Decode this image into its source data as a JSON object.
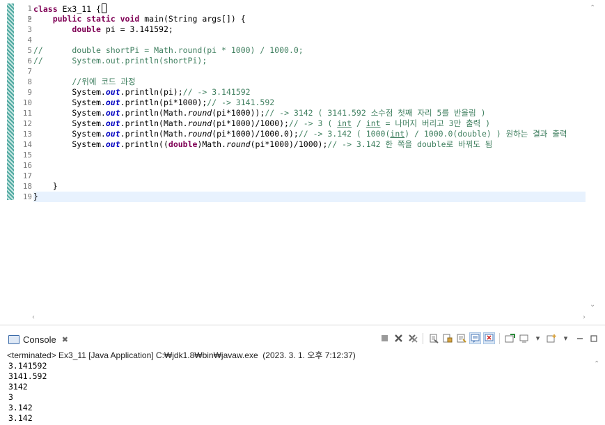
{
  "editor": {
    "line_numbers": [
      "1",
      "2",
      "3",
      "4",
      "5",
      "6",
      "7",
      "8",
      "9",
      "10",
      "11",
      "12",
      "13",
      "14",
      "15",
      "16",
      "17",
      "18",
      "19"
    ],
    "fold_marker": "⊖",
    "lines": {
      "l1": {
        "kw": "class",
        "rest": " Ex3_11 {"
      },
      "l2": {
        "indent": "    ",
        "kw1": "public static void",
        "rest": " main(String args[]) {"
      },
      "l3": {
        "indent": "        ",
        "kw": "double",
        "rest": " pi = 3.141592;"
      },
      "l5": "//      double shortPi = Math.round(pi * 1000) / 1000.0;",
      "l6": "//      System.out.println(shortPi);",
      "l8": "        //위에 코드 과정",
      "l9": {
        "a": "        System.",
        "field": "out",
        "b": ".println(pi);",
        "c": "// -> 3.141592"
      },
      "l10": {
        "a": "        System.",
        "field": "out",
        "b": ".println(pi*1000);",
        "c": "// -> 3141.592"
      },
      "l11": {
        "a": "        System.",
        "field": "out",
        "b": ".println(Math.",
        "m": "round",
        "d": "(pi*1000));",
        "c": "// -> 3142 ( 3141.592 소수점 첫째 자리 5를 반올림 )"
      },
      "l12": {
        "a": "        System.",
        "field": "out",
        "b": ".println(Math.",
        "m": "round",
        "d": "(pi*1000)/1000);",
        "c1": "// -> 3 ( ",
        "u1": "int",
        "c2": " / ",
        "u2": "int",
        "c3": " = 나머지 버리고 3만 출력 )"
      },
      "l13": {
        "a": "        System.",
        "field": "out",
        "b": ".println(Math.",
        "m": "round",
        "d": "(pi*1000)/1000.0);",
        "c1": "// -> 3.142 ( 1000(",
        "u1": "int",
        "c3": ") / 1000.0(double) ) 원하는 결과 출력"
      },
      "l14": {
        "a": "        System.",
        "field": "out",
        "b": ".println((",
        "kw": "double",
        "b2": ")Math.",
        "m": "round",
        "d": "(pi*1000)/1000);",
        "c": "// -> 3.142 한 쪽을 double로 바꿔도 됨"
      },
      "l18": "    }",
      "l19": "}"
    }
  },
  "console": {
    "tab_label": "Console",
    "tab_close": "✖",
    "status": "<terminated> Ex3_11 [Java Application] C:₩jdk1.8₩bin₩javaw.exe  (2023. 3. 1. 오후 7:12:37)",
    "output": [
      "3.141592",
      "3141.592",
      "3142",
      "3",
      "3.142",
      "3.142"
    ]
  },
  "toolbar": {
    "icons": [
      "terminate-icon",
      "remove-launch-icon",
      "remove-all-icon",
      "clear-console-icon",
      "scroll-lock-icon",
      "word-wrap-icon",
      "show-stdout-icon",
      "show-stderr-icon",
      "pin-console-icon",
      "display-console-icon",
      "open-console-icon",
      "view-menu-icon",
      "minimize-icon",
      "maximize-icon"
    ]
  },
  "colors": {
    "keyword": "#7f0055",
    "comment": "#3f7f5f",
    "field": "#0000c0",
    "current_line": "#e8f2fe"
  }
}
